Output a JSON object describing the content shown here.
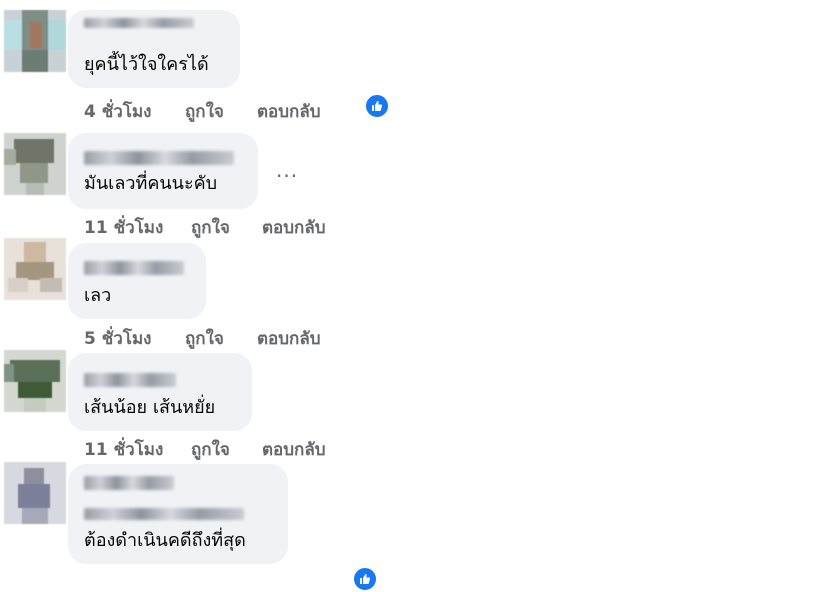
{
  "comments": [
    {
      "text": "ยุคนี้ไว้ใจใครได้",
      "time": "4 ชั่วโมง",
      "like": "ถูกใจ",
      "reply": "ตอบกลับ",
      "reacted": true
    },
    {
      "text": "มันเลวที่คนนะคับ",
      "time": "11 ชั่วโมง",
      "like": "ถูกใจ",
      "reply": "ตอบกลับ",
      "more": "..."
    },
    {
      "text": "เลว",
      "time": "5 ชั่วโมง",
      "like": "ถูกใจ",
      "reply": "ตอบกลับ"
    },
    {
      "text": "เส้นน้อย เส้นหยั่ย",
      "time": "11 ชั่วโมง",
      "like": "ถูกใจ",
      "reply": "ตอบกลับ"
    },
    {
      "text": "ต้องดำเนินคดีถึงที่สุด",
      "time": "",
      "like": "",
      "reply": "",
      "reacted": true
    }
  ],
  "colors": {
    "bubble": "#f0f2f5",
    "meta_text": "#65676b",
    "reaction_blue": "#1877f2"
  },
  "icons": {
    "reaction": "like-thumb-icon",
    "more": "more-options-icon"
  }
}
